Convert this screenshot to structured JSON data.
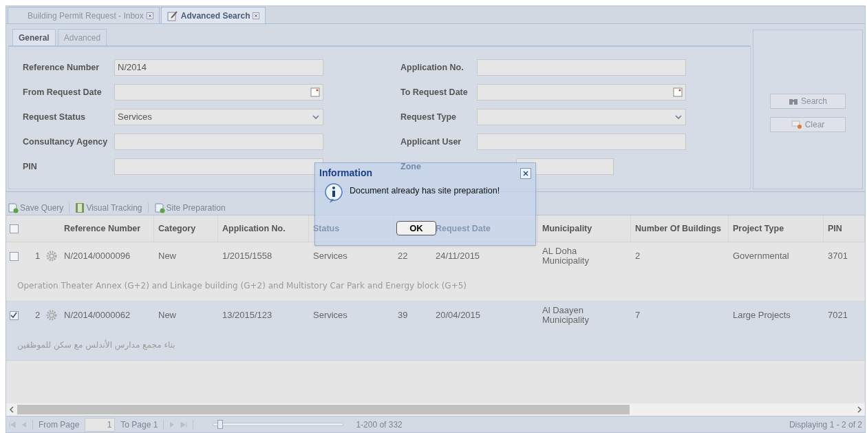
{
  "tabs": [
    {
      "label": "Building Permit Request - Inbox",
      "selected": false
    },
    {
      "label": "Advanced Search",
      "selected": true
    }
  ],
  "sub_tabs": [
    {
      "label": "General",
      "selected": true
    },
    {
      "label": "Advanced",
      "selected": false
    }
  ],
  "form": {
    "left": [
      {
        "label": "Reference Number",
        "kind": "text",
        "value": "N/2014"
      },
      {
        "label": "From Request Date",
        "kind": "date"
      },
      {
        "label": "Request Status",
        "kind": "select",
        "value": "Services"
      },
      {
        "label": "Consultancy Agency",
        "kind": "text"
      },
      {
        "label": "PIN",
        "kind": "text"
      }
    ],
    "right": [
      {
        "label": "Application No.",
        "kind": "text"
      },
      {
        "label": "To Request Date",
        "kind": "date"
      },
      {
        "label": "Request Type",
        "kind": "select"
      },
      {
        "label": "Applicant User",
        "kind": "text"
      },
      {
        "label": "Zone",
        "kind": "short"
      }
    ]
  },
  "actions": [
    {
      "label": "Search",
      "kind": "search"
    },
    {
      "label": "Clear",
      "kind": "clear"
    }
  ],
  "toolbar": [
    {
      "label": "Save Query",
      "kind": "document"
    },
    {
      "label": "Visual Tracking",
      "kind": "film"
    },
    {
      "label": "Site Preparation",
      "kind": "document"
    }
  ],
  "table": {
    "header_checked": false,
    "columns": [
      {
        "label": "Reference Number"
      },
      {
        "label": "Category"
      },
      {
        "label": "Application No."
      },
      {
        "label": "Status"
      },
      {},
      {
        "label": "Request Date"
      },
      {
        "label": "Municipality"
      },
      {
        "label": "Number Of Buildings"
      },
      {
        "label": "Project Type"
      },
      {
        "label": "PIN"
      }
    ],
    "rows": [
      {
        "checked": false,
        "number": "1",
        "cells": [
          "N/2014/0000096",
          "New",
          "1/2015/1558",
          "Services",
          "22",
          "24/11/2015",
          "AL Doha Municipality",
          "2",
          "Governmental",
          "3701"
        ],
        "description": "Operation Theater Annex (G+2) and Linkage building (G+2) and Multistory Car Park and Energy block (G+5)"
      },
      {
        "checked": true,
        "number": "2",
        "cells": [
          "N/2014/0000062",
          "New",
          "13/2015/123",
          "Services",
          "39",
          "20/04/2015",
          "Al Daayen Municipality",
          "7",
          "Large Projects",
          "7021"
        ],
        "description": "بناء مجمع مدارس الأندلس مع سكن للموظفين"
      }
    ]
  },
  "dialog": {
    "title": "Information",
    "message": "Document already has site preparation!",
    "button": "OK"
  },
  "paging": {
    "from_label": "From Page",
    "page": "1",
    "to_label": "To Page 1",
    "slider": {
      "level": 0.03
    },
    "range": "1-200 of 332",
    "display": "Displaying 1 - 2 of 2"
  }
}
